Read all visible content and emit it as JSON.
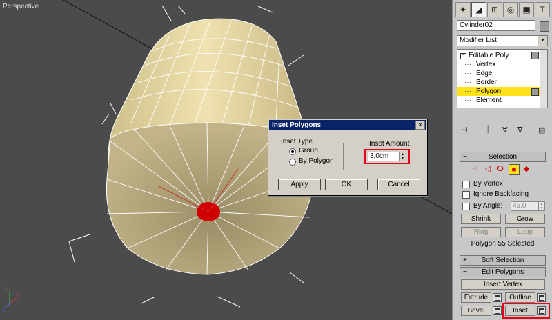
{
  "viewport": {
    "label": "Perspective"
  },
  "command_panel": {
    "tab_icons": [
      "create-icon",
      "modify-icon",
      "hierarchy-icon",
      "motion-icon",
      "display-icon",
      "utilities-icon"
    ],
    "object_name": "Cylinder02",
    "modifier_list": "Modifier List",
    "stack": {
      "root": "Editable Poly",
      "items": [
        "Vertex",
        "Edge",
        "Border",
        "Polygon",
        "Element"
      ],
      "selected": "Polygon"
    }
  },
  "selection_rollout": {
    "title": "Selection",
    "by_vertex": "By Vertex",
    "ignore_backfacing": "Ignore Backfacing",
    "by_angle": "By Angle:",
    "angle_value": "45,0",
    "shrink": "Shrink",
    "grow": "Grow",
    "ring": "Ring",
    "loop": "Loop",
    "status": "Polygon 55 Selected"
  },
  "soft_selection_rollout": {
    "title": "Soft Selection"
  },
  "edit_polygons_rollout": {
    "title": "Edit Polygons",
    "insert_vertex": "Insert Vertex",
    "extrude": "Extrude",
    "outline": "Outline",
    "bevel": "Bevel",
    "inset": "Inset"
  },
  "dialog": {
    "title": "Inset Polygons",
    "close": "✕",
    "inset_type_label": "Inset Type",
    "group": "Group",
    "by_polygon": "By Polygon",
    "amount_label": "Inset Amount",
    "amount_value": "3,0cm",
    "apply": "Apply",
    "ok": "OK",
    "cancel": "Cancel"
  },
  "colors": {
    "highlight": "#e6001a",
    "selected": "#ffe21a",
    "title_bar": "#0a246a",
    "mesh": "#e9dca6"
  }
}
